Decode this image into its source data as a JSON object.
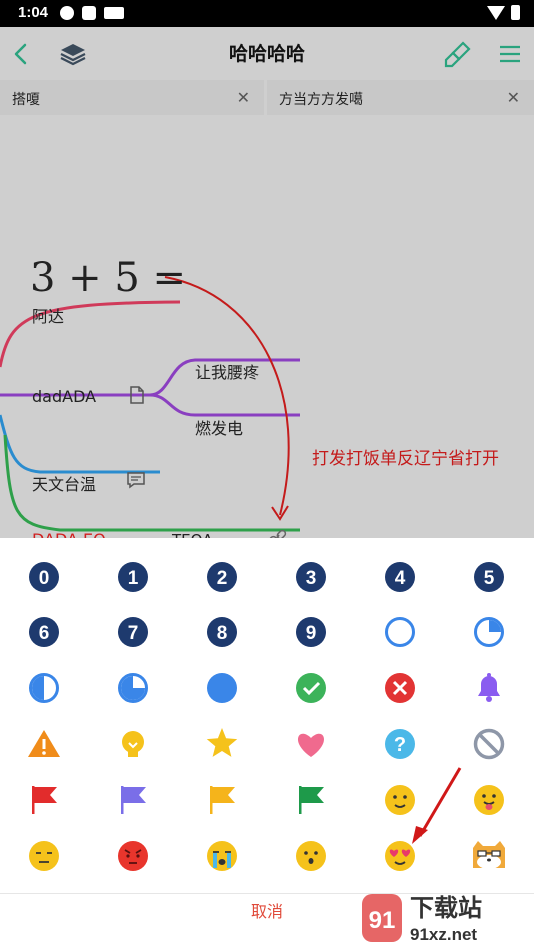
{
  "status": {
    "time": "1:04"
  },
  "header": {
    "title": "哈哈哈哈"
  },
  "tabs": [
    {
      "label": "搭嗄"
    },
    {
      "label": "方当方方发噶"
    }
  ],
  "mindmap": {
    "formula": "3 + 5 =",
    "nodes": {
      "ada": "阿达",
      "dadada": "dadADA",
      "rangwo": "让我腰疼",
      "ranfa": "燃发电",
      "tianwen": "天文台温",
      "dadaeq": "DADA EQ",
      "teqa": "TEQA"
    },
    "annotation": "打发打饭单反辽宁省打开"
  },
  "emojis": [
    "number-0-icon",
    "number-1-icon",
    "number-2-icon",
    "number-3-icon",
    "number-4-icon",
    "number-5-icon",
    "number-6-icon",
    "number-7-icon",
    "number-8-icon",
    "number-9-icon",
    "progress-empty-icon",
    "progress-quarter-icon",
    "progress-half-icon",
    "progress-three-quarter-icon",
    "progress-full-icon",
    "check-icon",
    "cross-icon",
    "bell-icon",
    "warning-icon",
    "lightbulb-icon",
    "star-icon",
    "heart-icon",
    "question-icon",
    "forbidden-icon",
    "red-flag-icon",
    "purple-flag-icon",
    "yellow-flag-icon",
    "green-flag-icon",
    "smile-face-icon",
    "tongue-face-icon",
    "neutral-face-icon",
    "angry-face-icon",
    "crying-face-icon",
    "surprised-face-icon",
    "heart-eyes-face-icon",
    "cat-face-icon"
  ],
  "digits": [
    "0",
    "1",
    "2",
    "3",
    "4",
    "5",
    "6",
    "7",
    "8",
    "9"
  ],
  "cancel_label": "取消",
  "watermark": {
    "brand": "下载站",
    "domain": "91xz.net"
  },
  "colors": {
    "accent": "#2aa37e",
    "navy": "#1e3a6e",
    "blue": "#3a86e8",
    "red": "#e33b3b"
  }
}
